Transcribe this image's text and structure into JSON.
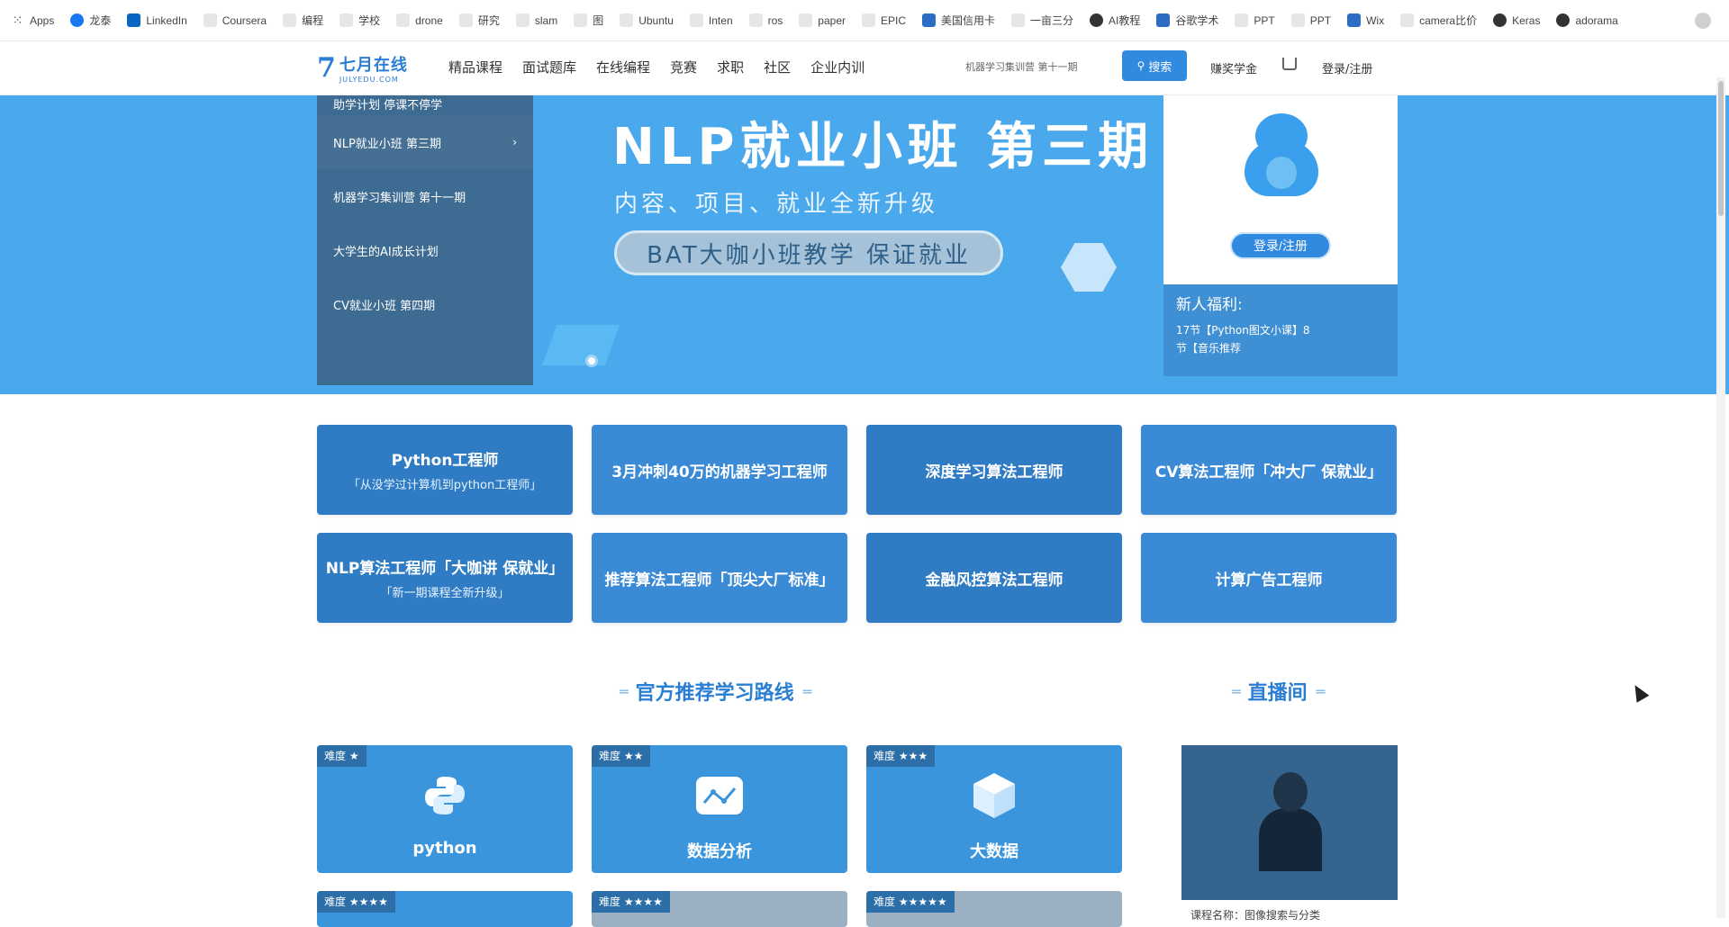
{
  "bookmarks": [
    {
      "label": "Apps",
      "icon": "apps-icon",
      "cls": "apps"
    },
    {
      "label": "龙泰",
      "icon": "facebook-icon",
      "cls": "fb"
    },
    {
      "label": "LinkedIn",
      "icon": "linkedin-icon",
      "cls": "li"
    },
    {
      "label": "Coursera",
      "icon": "coursera-icon",
      "cls": "gen"
    },
    {
      "label": "编程",
      "icon": "bookmark-icon",
      "cls": "gen"
    },
    {
      "label": "学校",
      "icon": "bookmark-icon",
      "cls": "gen"
    },
    {
      "label": "drone",
      "icon": "bookmark-icon",
      "cls": "gen"
    },
    {
      "label": "研究",
      "icon": "bookmark-icon",
      "cls": "gen"
    },
    {
      "label": "slam",
      "icon": "bookmark-icon",
      "cls": "gen"
    },
    {
      "label": "图",
      "icon": "bookmark-icon",
      "cls": "gen"
    },
    {
      "label": "Ubuntu",
      "icon": "bookmark-icon",
      "cls": "gen"
    },
    {
      "label": "Inten",
      "icon": "bookmark-icon",
      "cls": "gen"
    },
    {
      "label": "ros",
      "icon": "bookmark-icon",
      "cls": "gen"
    },
    {
      "label": "paper",
      "icon": "bookmark-icon",
      "cls": "gen"
    },
    {
      "label": "EPIC",
      "icon": "bookmark-icon",
      "cls": "gen"
    },
    {
      "label": "美国信用卡",
      "icon": "bookmark-icon",
      "cls": "blue"
    },
    {
      "label": "一亩三分",
      "icon": "bookmark-icon",
      "cls": "gen"
    },
    {
      "label": "AI教程",
      "icon": "globe-icon",
      "cls": "globe"
    },
    {
      "label": "谷歌学术",
      "icon": "scholar-icon",
      "cls": "blue"
    },
    {
      "label": "PPT",
      "icon": "bookmark-icon",
      "cls": "gen"
    },
    {
      "label": "PPT",
      "icon": "bookmark-icon",
      "cls": "gen"
    },
    {
      "label": "Wix",
      "icon": "wix-icon",
      "cls": "blue"
    },
    {
      "label": "camera比价",
      "icon": "bookmark-icon",
      "cls": "gen"
    },
    {
      "label": "Keras",
      "icon": "globe-icon",
      "cls": "globe"
    },
    {
      "label": "adorama",
      "icon": "globe-icon",
      "cls": "globe"
    }
  ],
  "header": {
    "logo_cn": "七月在线",
    "logo_en": "JULYEDU.COM",
    "logo_mark": "7",
    "nav": [
      "精品课程",
      "面试题库",
      "在线编程",
      "竞赛",
      "求职",
      "社区",
      "企业内训"
    ],
    "search_value": "机器学习集训营 第十一期",
    "search_label": "搜索",
    "reward_label": "赚奖学金",
    "login_label": "登录/注册"
  },
  "banner": {
    "side_menu": [
      {
        "label": "助学计划 停课不停学",
        "active": false
      },
      {
        "label": "NLP就业小班 第三期",
        "active": true
      },
      {
        "label": "机器学习集训营 第十一期",
        "active": false
      },
      {
        "label": "大学生的AI成长计划",
        "active": false
      },
      {
        "label": "CV就业小班 第四期",
        "active": false
      }
    ],
    "chevron": "›",
    "title": "NLP就业小班 第三期",
    "subtitle": "内容、项目、就业全新升级",
    "pill": "BAT大咖小班教学 保证就业",
    "login_button": "登录/注册",
    "welfare_title": "新人福利:",
    "welfare_text": "17节【Python图文小课】8节【音乐推荐"
  },
  "courses": [
    {
      "title": "Python工程师",
      "sub": "「从没学过计算机到python工程师」"
    },
    {
      "title": "3月冲刺40万的机器学习工程师",
      "sub": ""
    },
    {
      "title": "深度学习算法工程师",
      "sub": ""
    },
    {
      "title": "CV算法工程师「冲大厂 保就业」",
      "sub": ""
    },
    {
      "title": "NLP算法工程师「大咖讲 保就业」",
      "sub": "「新一期课程全新升级」"
    },
    {
      "title": "推荐算法工程师「顶尖大厂标准」",
      "sub": ""
    },
    {
      "title": "金融风控算法工程师",
      "sub": ""
    },
    {
      "title": "计算广告工程师",
      "sub": ""
    }
  ],
  "sections": {
    "path_title": "官方推荐学习路线",
    "live_title": "直播间",
    "deco": "═"
  },
  "paths": [
    {
      "diff": "难度 ★",
      "name": "python",
      "icon": "python-icon"
    },
    {
      "diff": "难度 ★★",
      "name": "数据分析",
      "icon": "chart-icon"
    },
    {
      "diff": "难度 ★★★",
      "name": "大数据",
      "icon": "cube-icon"
    }
  ],
  "paths_row2": [
    {
      "diff": "难度 ★★★★"
    },
    {
      "diff": "难度 ★★★★"
    },
    {
      "diff": "难度 ★★★★★"
    }
  ],
  "live": {
    "caption": "课程名称：图像搜索与分类"
  }
}
